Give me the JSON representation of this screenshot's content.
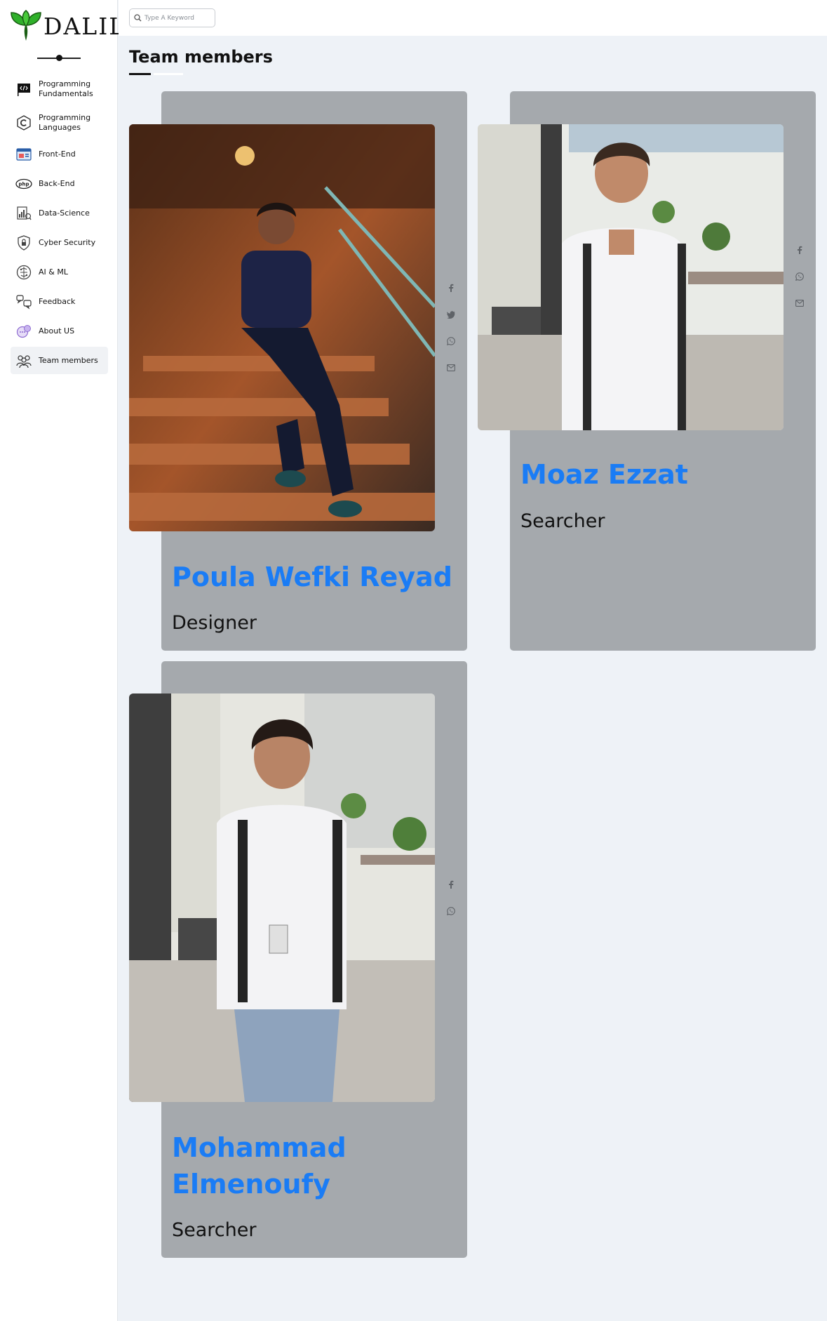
{
  "brand": {
    "logo_text": "DALIL"
  },
  "search": {
    "placeholder": "Type A Keyword",
    "value": ""
  },
  "sidebar": {
    "items": [
      {
        "line1": "Programming",
        "line2": "Fundamentals",
        "icon": "code-flag-icon"
      },
      {
        "line1": "Programming",
        "line2": "Languages",
        "icon": "c-language-icon"
      },
      {
        "line1": "Front-End",
        "line2": "",
        "icon": "browser-window-icon"
      },
      {
        "line1": "Back-End",
        "line2": "",
        "icon": "php-icon"
      },
      {
        "line1": "Data-Science",
        "line2": "",
        "icon": "data-science-icon"
      },
      {
        "line1": "Cyber Security",
        "line2": "",
        "icon": "shield-lock-icon"
      },
      {
        "line1": "AI & ML",
        "line2": "",
        "icon": "brain-chip-icon"
      },
      {
        "line1": "Feedback",
        "line2": "",
        "icon": "feedback-icon"
      },
      {
        "line1": "About US",
        "line2": "",
        "icon": "about-icon"
      },
      {
        "line1": "Team members",
        "line2": "",
        "icon": "team-icon",
        "active": true
      }
    ]
  },
  "page": {
    "title": "Team members"
  },
  "members": [
    {
      "name": "Poula Wefki Reyad",
      "role": "Designer",
      "socials": [
        "facebook-icon",
        "twitter-icon",
        "whatsapp-icon",
        "mail-icon"
      ]
    },
    {
      "name": "Moaz Ezzat",
      "role": "Searcher",
      "socials": [
        "facebook-icon",
        "whatsapp-icon",
        "mail-icon"
      ]
    },
    {
      "name_line1": "Mohammad",
      "name_line2": "Elmenoufy",
      "role": "Searcher",
      "socials": [
        "facebook-icon",
        "whatsapp-icon"
      ]
    }
  ],
  "colors": {
    "accent": "#1a7cf5",
    "card": "#a5a9ad",
    "background": "#eef2f7",
    "logo_green": "#2fb02a"
  }
}
